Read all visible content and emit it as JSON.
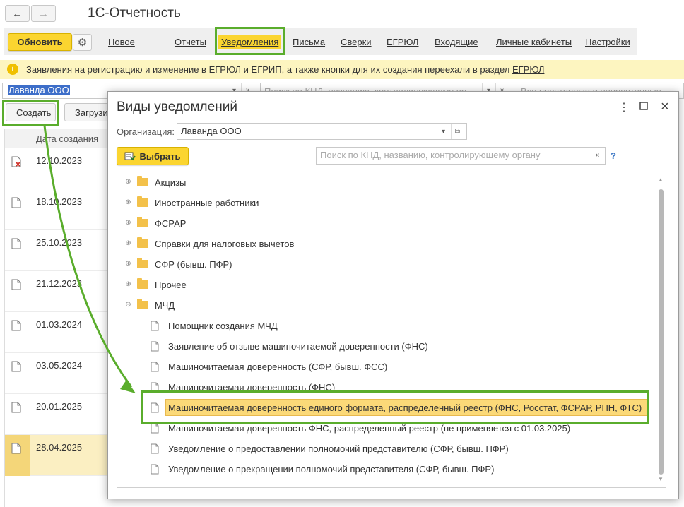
{
  "app": {
    "title": "1С-Отчетность"
  },
  "toolbar": {
    "refresh_label": "Обновить",
    "tabs": [
      "Новое",
      "Отчеты",
      "Уведомления",
      "Письма",
      "Сверки",
      "ЕГРЮЛ",
      "Входящие",
      "Личные кабинеты",
      "Настройки"
    ],
    "active_tab": "Уведомления"
  },
  "infobar": {
    "text": "Заявления на регистрацию и изменение в ЕГРЮЛ и ЕГРИП, а также кнопки для их создания переехали в раздел",
    "link": "ЕГРЮЛ"
  },
  "filters": {
    "organization": "Лаванда ООО",
    "search_placeholder": "Поиск по КНД, названию, контролирующему ор",
    "status_placeholder": "Все прочтенные и непрочтенные"
  },
  "actions": {
    "create_label": "Создать",
    "upload_label": "Загрузи"
  },
  "list": {
    "column_date": "Дата создания",
    "rows": [
      {
        "date": "12.10.2023",
        "state": "error"
      },
      {
        "date": "18.10.2023",
        "state": "normal"
      },
      {
        "date": "25.10.2023",
        "state": "normal"
      },
      {
        "date": "21.12.2023",
        "state": "normal"
      },
      {
        "date": "01.03.2024",
        "state": "normal"
      },
      {
        "date": "03.05.2024",
        "state": "normal"
      },
      {
        "date": "20.01.2025",
        "state": "normal"
      },
      {
        "date": "28.04.2025",
        "state": "selected"
      }
    ]
  },
  "dialog": {
    "title": "Виды уведомлений",
    "org_label": "Организация:",
    "org_value": "Лаванда ООО",
    "choose_label": "Выбрать",
    "search_placeholder": "Поиск по КНД, названию, контролирующему органу",
    "help": "?",
    "tree": [
      {
        "label": "Акцизы",
        "kind": "folder",
        "expanded": false
      },
      {
        "label": "Иностранные работники",
        "kind": "folder",
        "expanded": false
      },
      {
        "label": "ФСРАР",
        "kind": "folder",
        "expanded": false
      },
      {
        "label": "Справки для налоговых вычетов",
        "kind": "folder",
        "expanded": false
      },
      {
        "label": "СФР (бывш. ПФР)",
        "kind": "folder",
        "expanded": false
      },
      {
        "label": "Прочее",
        "kind": "folder",
        "expanded": false
      },
      {
        "label": "МЧД",
        "kind": "folder",
        "expanded": true
      },
      {
        "label": "Помощник создания МЧД",
        "kind": "item"
      },
      {
        "label": "Заявление об отзыве машиночитаемой доверенности (ФНС)",
        "kind": "item"
      },
      {
        "label": "Машиночитаемая доверенность (СФР, бывш. ФСС)",
        "kind": "item"
      },
      {
        "label": "Машиночитаемая доверенность (ФНС)",
        "kind": "item"
      },
      {
        "label": "Машиночитаемая доверенность единого формата, распределенный реестр (ФНС, Росстат, ФСРАР, РПН, ФТС)",
        "kind": "item",
        "highlighted": true
      },
      {
        "label": "Машиночитаемая доверенность ФНС, распределенный реестр (не применяется с 01.03.2025)",
        "kind": "item"
      },
      {
        "label": "Уведомление о предоставлении полномочий представителю (СФР, бывш. ПФР)",
        "kind": "item"
      },
      {
        "label": "Уведомление о прекращении полномочий представителя (СФР, бывш. ПФР)",
        "kind": "item"
      }
    ]
  },
  "colors": {
    "accent_yellow": "#fbd530",
    "annotation_green": "#5aad2c",
    "highlight": "#fbd978"
  }
}
